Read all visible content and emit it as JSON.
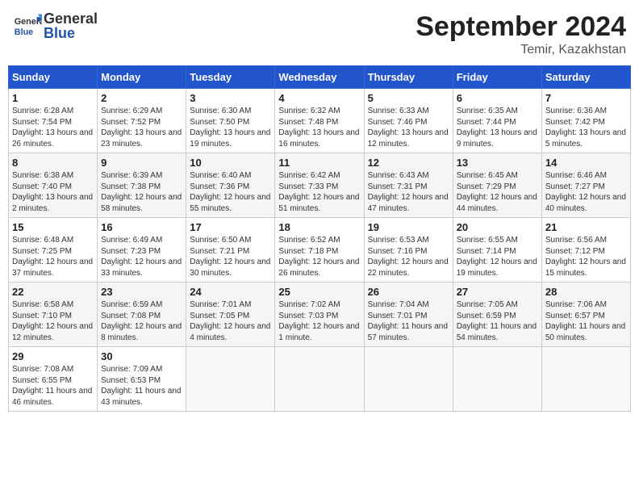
{
  "header": {
    "logo_general": "General",
    "logo_blue": "Blue",
    "month_title": "September 2024",
    "location": "Temir, Kazakhstan"
  },
  "weekdays": [
    "Sunday",
    "Monday",
    "Tuesday",
    "Wednesday",
    "Thursday",
    "Friday",
    "Saturday"
  ],
  "weeks": [
    [
      {
        "day": "1",
        "sunrise": "Sunrise: 6:28 AM",
        "sunset": "Sunset: 7:54 PM",
        "daylight": "Daylight: 13 hours and 26 minutes."
      },
      {
        "day": "2",
        "sunrise": "Sunrise: 6:29 AM",
        "sunset": "Sunset: 7:52 PM",
        "daylight": "Daylight: 13 hours and 23 minutes."
      },
      {
        "day": "3",
        "sunrise": "Sunrise: 6:30 AM",
        "sunset": "Sunset: 7:50 PM",
        "daylight": "Daylight: 13 hours and 19 minutes."
      },
      {
        "day": "4",
        "sunrise": "Sunrise: 6:32 AM",
        "sunset": "Sunset: 7:48 PM",
        "daylight": "Daylight: 13 hours and 16 minutes."
      },
      {
        "day": "5",
        "sunrise": "Sunrise: 6:33 AM",
        "sunset": "Sunset: 7:46 PM",
        "daylight": "Daylight: 13 hours and 12 minutes."
      },
      {
        "day": "6",
        "sunrise": "Sunrise: 6:35 AM",
        "sunset": "Sunset: 7:44 PM",
        "daylight": "Daylight: 13 hours and 9 minutes."
      },
      {
        "day": "7",
        "sunrise": "Sunrise: 6:36 AM",
        "sunset": "Sunset: 7:42 PM",
        "daylight": "Daylight: 13 hours and 5 minutes."
      }
    ],
    [
      {
        "day": "8",
        "sunrise": "Sunrise: 6:38 AM",
        "sunset": "Sunset: 7:40 PM",
        "daylight": "Daylight: 13 hours and 2 minutes."
      },
      {
        "day": "9",
        "sunrise": "Sunrise: 6:39 AM",
        "sunset": "Sunset: 7:38 PM",
        "daylight": "Daylight: 12 hours and 58 minutes."
      },
      {
        "day": "10",
        "sunrise": "Sunrise: 6:40 AM",
        "sunset": "Sunset: 7:36 PM",
        "daylight": "Daylight: 12 hours and 55 minutes."
      },
      {
        "day": "11",
        "sunrise": "Sunrise: 6:42 AM",
        "sunset": "Sunset: 7:33 PM",
        "daylight": "Daylight: 12 hours and 51 minutes."
      },
      {
        "day": "12",
        "sunrise": "Sunrise: 6:43 AM",
        "sunset": "Sunset: 7:31 PM",
        "daylight": "Daylight: 12 hours and 47 minutes."
      },
      {
        "day": "13",
        "sunrise": "Sunrise: 6:45 AM",
        "sunset": "Sunset: 7:29 PM",
        "daylight": "Daylight: 12 hours and 44 minutes."
      },
      {
        "day": "14",
        "sunrise": "Sunrise: 6:46 AM",
        "sunset": "Sunset: 7:27 PM",
        "daylight": "Daylight: 12 hours and 40 minutes."
      }
    ],
    [
      {
        "day": "15",
        "sunrise": "Sunrise: 6:48 AM",
        "sunset": "Sunset: 7:25 PM",
        "daylight": "Daylight: 12 hours and 37 minutes."
      },
      {
        "day": "16",
        "sunrise": "Sunrise: 6:49 AM",
        "sunset": "Sunset: 7:23 PM",
        "daylight": "Daylight: 12 hours and 33 minutes."
      },
      {
        "day": "17",
        "sunrise": "Sunrise: 6:50 AM",
        "sunset": "Sunset: 7:21 PM",
        "daylight": "Daylight: 12 hours and 30 minutes."
      },
      {
        "day": "18",
        "sunrise": "Sunrise: 6:52 AM",
        "sunset": "Sunset: 7:18 PM",
        "daylight": "Daylight: 12 hours and 26 minutes."
      },
      {
        "day": "19",
        "sunrise": "Sunrise: 6:53 AM",
        "sunset": "Sunset: 7:16 PM",
        "daylight": "Daylight: 12 hours and 22 minutes."
      },
      {
        "day": "20",
        "sunrise": "Sunrise: 6:55 AM",
        "sunset": "Sunset: 7:14 PM",
        "daylight": "Daylight: 12 hours and 19 minutes."
      },
      {
        "day": "21",
        "sunrise": "Sunrise: 6:56 AM",
        "sunset": "Sunset: 7:12 PM",
        "daylight": "Daylight: 12 hours and 15 minutes."
      }
    ],
    [
      {
        "day": "22",
        "sunrise": "Sunrise: 6:58 AM",
        "sunset": "Sunset: 7:10 PM",
        "daylight": "Daylight: 12 hours and 12 minutes."
      },
      {
        "day": "23",
        "sunrise": "Sunrise: 6:59 AM",
        "sunset": "Sunset: 7:08 PM",
        "daylight": "Daylight: 12 hours and 8 minutes."
      },
      {
        "day": "24",
        "sunrise": "Sunrise: 7:01 AM",
        "sunset": "Sunset: 7:05 PM",
        "daylight": "Daylight: 12 hours and 4 minutes."
      },
      {
        "day": "25",
        "sunrise": "Sunrise: 7:02 AM",
        "sunset": "Sunset: 7:03 PM",
        "daylight": "Daylight: 12 hours and 1 minute."
      },
      {
        "day": "26",
        "sunrise": "Sunrise: 7:04 AM",
        "sunset": "Sunset: 7:01 PM",
        "daylight": "Daylight: 11 hours and 57 minutes."
      },
      {
        "day": "27",
        "sunrise": "Sunrise: 7:05 AM",
        "sunset": "Sunset: 6:59 PM",
        "daylight": "Daylight: 11 hours and 54 minutes."
      },
      {
        "day": "28",
        "sunrise": "Sunrise: 7:06 AM",
        "sunset": "Sunset: 6:57 PM",
        "daylight": "Daylight: 11 hours and 50 minutes."
      }
    ],
    [
      {
        "day": "29",
        "sunrise": "Sunrise: 7:08 AM",
        "sunset": "Sunset: 6:55 PM",
        "daylight": "Daylight: 11 hours and 46 minutes."
      },
      {
        "day": "30",
        "sunrise": "Sunrise: 7:09 AM",
        "sunset": "Sunset: 6:53 PM",
        "daylight": "Daylight: 11 hours and 43 minutes."
      },
      null,
      null,
      null,
      null,
      null
    ]
  ]
}
